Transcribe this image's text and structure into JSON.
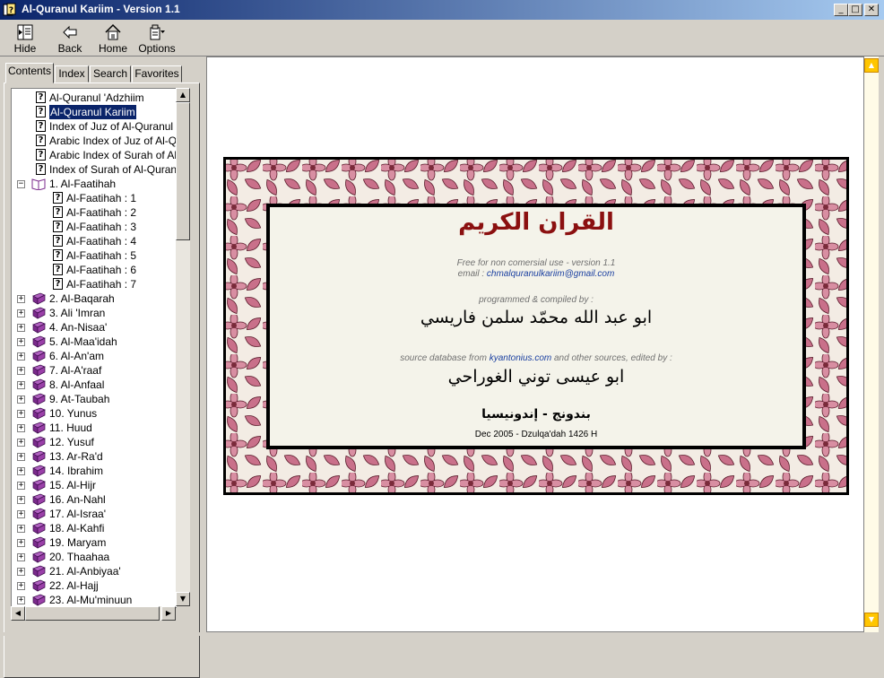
{
  "window": {
    "title": "Al-Quranul Kariim - Version 1.1"
  },
  "toolbar": {
    "hide": "Hide",
    "back": "Back",
    "home": "Home",
    "options": "Options"
  },
  "tabs": [
    "Contents",
    "Index",
    "Search",
    "Favorites"
  ],
  "tree": {
    "top_items": [
      "Al-Quranul 'Adzhiim",
      "Al-Quranul Kariim",
      "Index of Juz of Al-Quranul Kar",
      "Arabic Index of Juz of Al-Qura",
      "Arabic Index of Surah of Al-Qu",
      "Index of Surah of Al-Quranul K"
    ],
    "selected_item": "Al-Quranul Kariim",
    "open_surah": "1. Al-Faatihah",
    "open_surah_children": [
      "Al-Faatihah : 1",
      "Al-Faatihah : 2",
      "Al-Faatihah : 3",
      "Al-Faatihah : 4",
      "Al-Faatihah : 5",
      "Al-Faatihah : 6",
      "Al-Faatihah : 7"
    ],
    "closed_surahs": [
      "2. Al-Baqarah",
      "3. Ali 'Imran",
      "4. An-Nisaa'",
      "5. Al-Maa'idah",
      "6. Al-An'am",
      "7. Al-A'raaf",
      "8. Al-Anfaal",
      "9. At-Taubah",
      "10. Yunus",
      "11. Huud",
      "12. Yusuf",
      "13. Ar-Ra'd",
      "14. Ibrahim",
      "15. Al-Hijr",
      "16. An-Nahl",
      "17. Al-Israa'",
      "18. Al-Kahfi",
      "19. Maryam",
      "20. Thaahaa",
      "21. Al-Anbiyaa'",
      "22. Al-Hajj",
      "23. Al-Mu'minuun"
    ]
  },
  "banner": {
    "arabic_title": "القران الكريم",
    "free_line": "Free for non comersial use - version 1.1",
    "email_label": "email :",
    "email": "chmalquranulkariim@gmail.com",
    "programmed_label": "programmed & compiled by :",
    "author_arabic": "ابو عبد الله محمّد سلمن فاريسي",
    "source_label": "source database from",
    "source_site": "kyantonius.com",
    "source_rest": "and other sources, edited by :",
    "editor_arabic": "ابو عيسى توني الغوراحي",
    "city_arabic": "بندونج - إندونيسيا",
    "date": "Dec 2005 - Dzulqa'dah 1426 H"
  },
  "colors": {
    "title_bar_start": "#0a246a",
    "title_bar_end": "#a6caf0",
    "selection": "#0a246a",
    "book_icon": "#7b2a8c",
    "banner_title": "#8b1010",
    "link": "#1a3fa0",
    "scroll_accent": "#ffc600",
    "flower_pink": "#c9708a"
  }
}
